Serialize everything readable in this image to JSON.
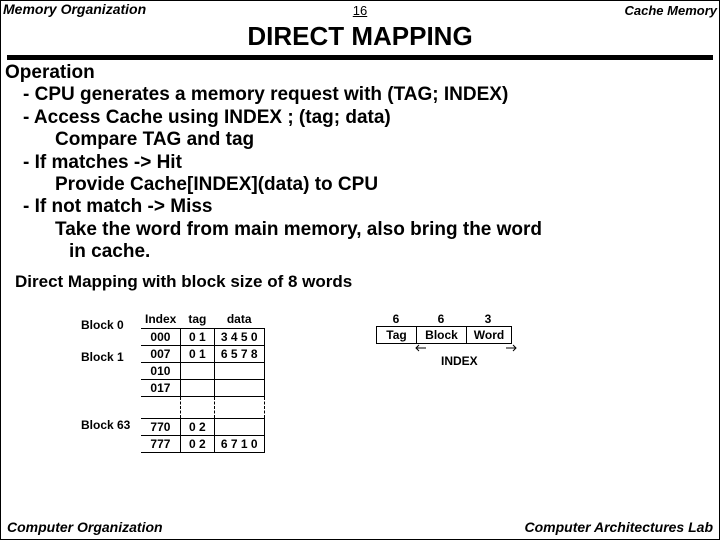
{
  "header": {
    "left": "Memory Organization",
    "mid": "16",
    "right": "Cache Memory"
  },
  "title": "DIRECT  MAPPING",
  "body": {
    "h": "Operation",
    "l1": "- CPU generates a memory request with (TAG; INDEX)",
    "l2": "- Access Cache using INDEX ; (tag; data)",
    "l3": "Compare TAG and tag",
    "l4": "- If matches -> Hit",
    "l5": "Provide Cache[INDEX](data) to CPU",
    "l6": "- If not match -> Miss",
    "l7": "Take the word from main memory, also bring the word",
    "l8": " in cache."
  },
  "sect": "Direct Mapping with block size of 8 words",
  "table": {
    "th_index": "Index",
    "th_tag": "tag",
    "th_data": "data",
    "r0a_i": "000",
    "r0a_t": "0 1",
    "r0a_d": "3 4 5 0",
    "r0b_i": "007",
    "r0b_t": "0 1",
    "r0b_d": "6 5 7 8",
    "r1a_i": "010",
    "r1b_i": "017",
    "r63a_i": "770",
    "r63a_t": "0 2",
    "r63b_i": "777",
    "r63b_t": "0 2",
    "r63b_d": "6 7 1 0"
  },
  "blocks": {
    "b0": "Block 0",
    "b1": "Block 1",
    "b63": "Block 63"
  },
  "fields": {
    "n0": "6",
    "n1": "6",
    "n2": "3",
    "f0": "Tag",
    "f1": "Block",
    "f2": "Word",
    "lbl": "INDEX"
  },
  "footer": {
    "left": "Computer Organization",
    "right": "Computer Architectures Lab"
  }
}
